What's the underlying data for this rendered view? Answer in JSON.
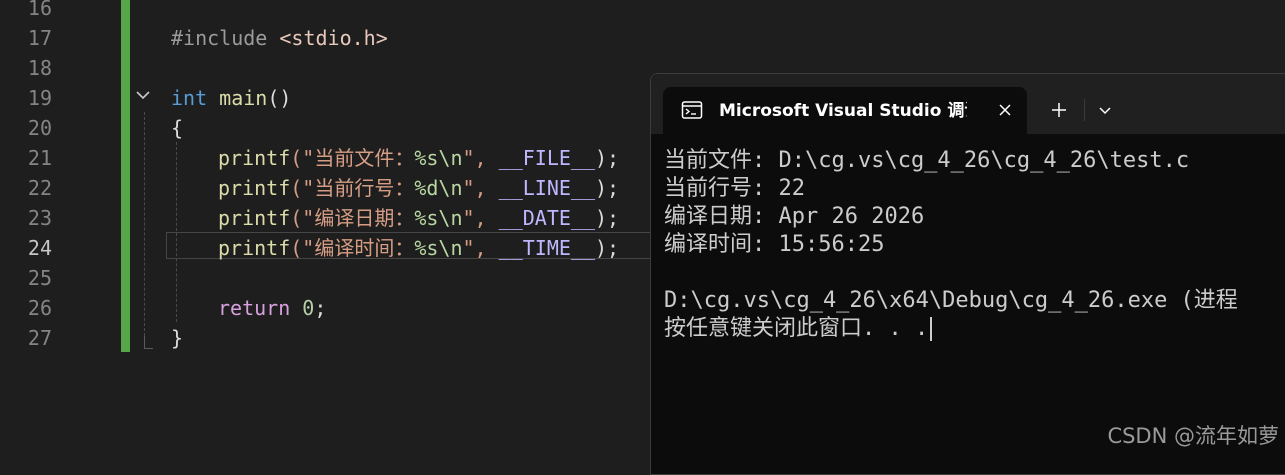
{
  "editor": {
    "line_numbers": [
      "16",
      "17",
      "18",
      "19",
      "20",
      "21",
      "22",
      "23",
      "24",
      "25",
      "26",
      "27"
    ],
    "active_line": "24",
    "code": {
      "l17": {
        "pre": "#include",
        "inc": "<stdio.h>"
      },
      "l19": {
        "kw": "int",
        "fn": "main",
        "paren": "()"
      },
      "l20": {
        "brace": "{"
      },
      "l21": {
        "fn": "printf",
        "open": "(\"",
        "str": "当前文件：",
        "fmt": "%s\\n",
        "close": "\",",
        "mac": "__FILE__",
        "end": ");"
      },
      "l22": {
        "fn": "printf",
        "open": "(\"",
        "str": "当前行号：",
        "fmt": "%d\\n",
        "close": "\",",
        "mac": "__LINE__",
        "end": ");"
      },
      "l23": {
        "fn": "printf",
        "open": "(\"",
        "str": "编译日期：",
        "fmt": "%s\\n",
        "close": "\",",
        "mac": "__DATE__",
        "end": ");"
      },
      "l24": {
        "fn": "printf",
        "open": "(\"",
        "str": "编译时间：",
        "fmt": "%s\\n",
        "close": "\",",
        "mac": "__TIME__",
        "end": ");"
      },
      "l26": {
        "ret": "return",
        "num": "0",
        "semi": ";"
      },
      "l27": {
        "brace": "}"
      }
    }
  },
  "terminal": {
    "tab_title": "Microsoft Visual Studio 调试控",
    "output": [
      "当前文件: D:\\cg.vs\\cg_4_26\\cg_4_26\\test.c",
      "当前行号: 22",
      "编译日期: Apr 26 2026",
      "编译时间: 15:56:25",
      "",
      "D:\\cg.vs\\cg_4_26\\x64\\Debug\\cg_4_26.exe (进程",
      "按任意键关闭此窗口. . ."
    ]
  },
  "watermark": "CSDN @流年如萝",
  "colors": {
    "editor_bg": "#1e1e1e",
    "change_bar": "#57a64a",
    "keyword": "#569cd6",
    "function": "#dcdcaa",
    "string": "#d69d85",
    "macro": "#beb7ff",
    "terminal_bg": "#0c0c0c"
  }
}
